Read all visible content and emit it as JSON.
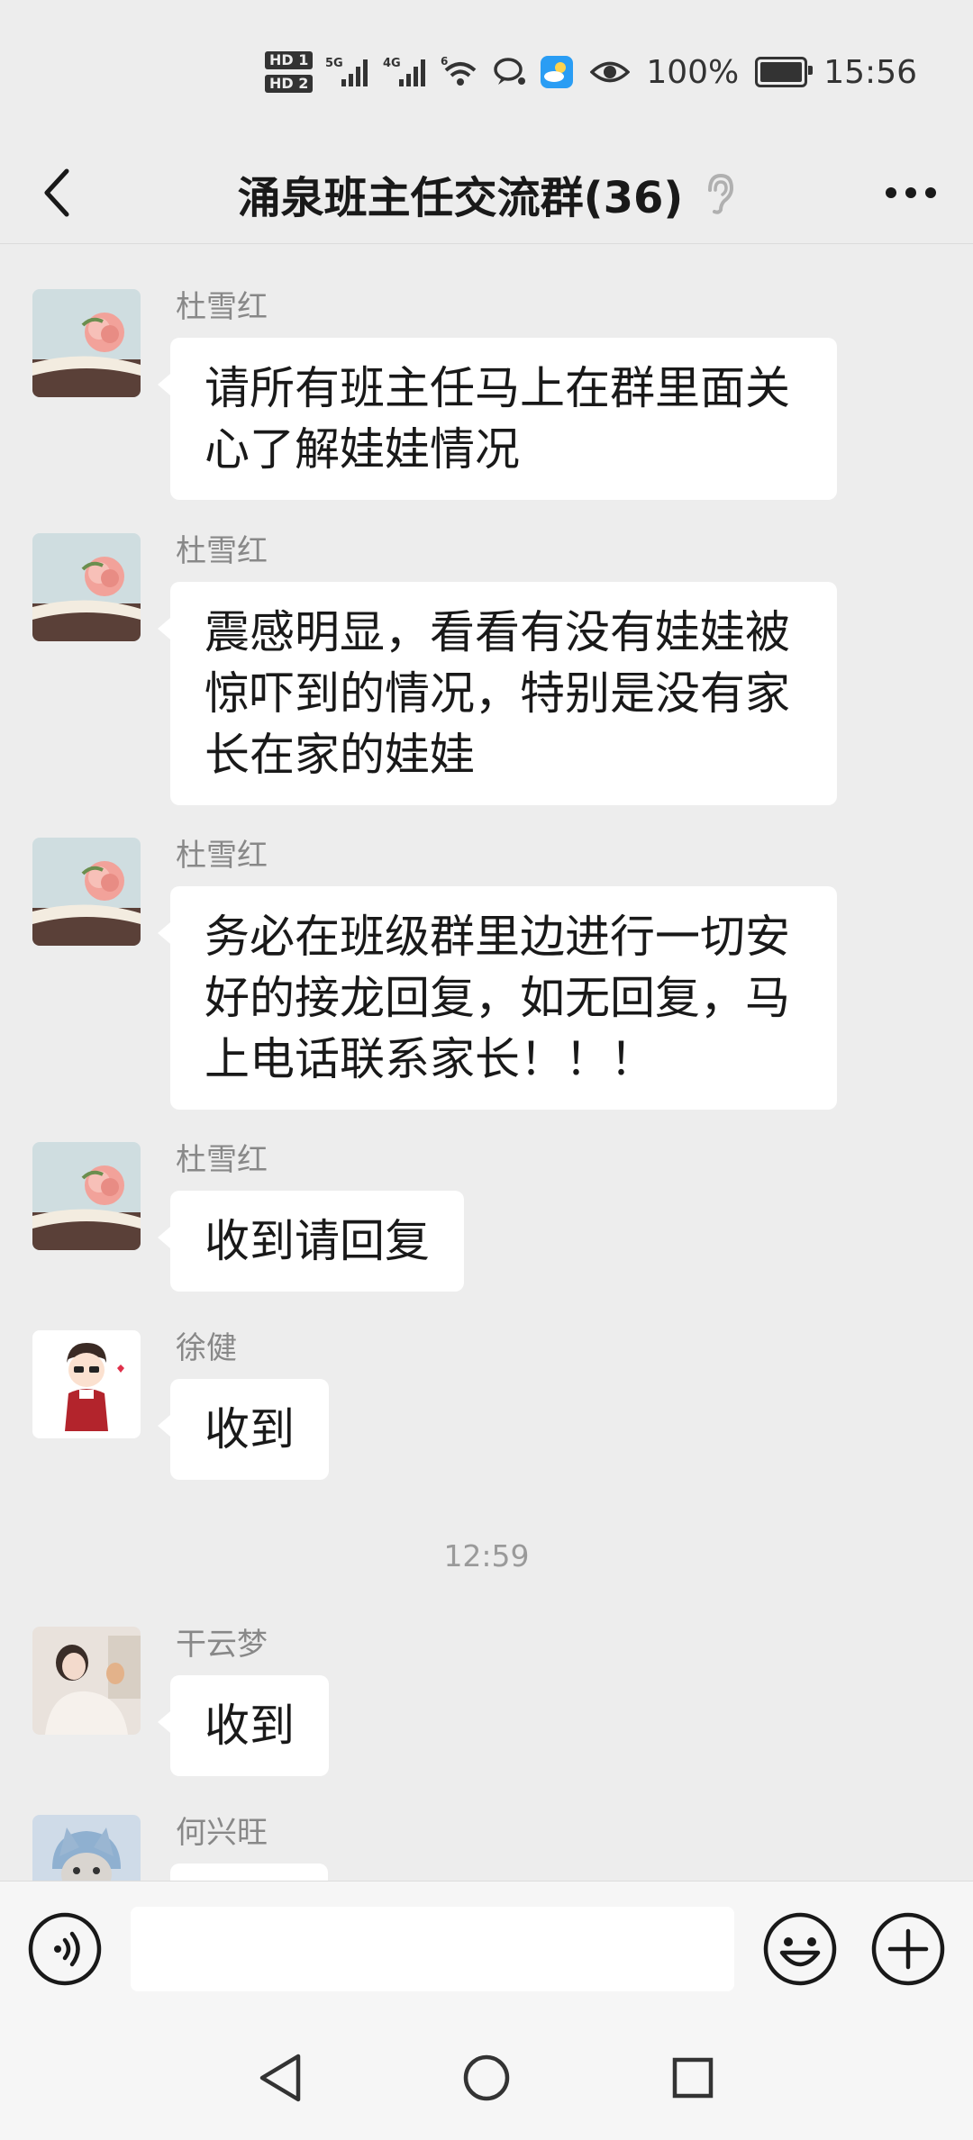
{
  "status_bar": {
    "network": [
      "HD 1",
      "HD 2"
    ],
    "signal_1": "5G",
    "signal_2": "4G",
    "wifi": "6",
    "battery": "100%",
    "battery_level": 1.0,
    "time": "15:56"
  },
  "header": {
    "title": "涌泉班主任交流群(36)",
    "icons": {
      "back": "back-arrow-icon",
      "muted": "ear-icon",
      "more": "more-dots-icon"
    }
  },
  "messages": [
    {
      "sender": "杜雪红",
      "avatar": "rose-book-avatar",
      "lines": [
        "请所有班主任马上在群里面关",
        "心了解娃娃情况"
      ]
    },
    {
      "sender": "杜雪红",
      "avatar": "rose-book-avatar",
      "lines": [
        "震感明显，看看有没有娃娃被",
        "惊吓到的情况，特别是没有家",
        "长在家的娃娃"
      ]
    },
    {
      "sender": "杜雪红",
      "avatar": "rose-book-avatar",
      "lines": [
        "务必在班级群里边进行一切安",
        "好的接龙回复，如无回复，马",
        "上电话联系家长！！！"
      ]
    },
    {
      "sender": "杜雪红",
      "avatar": "rose-book-avatar",
      "lines": [
        "收到请回复"
      ]
    },
    {
      "sender": "徐健",
      "avatar": "cartoon-boy-avatar",
      "lines": [
        "收到"
      ]
    },
    {
      "sender": "干云梦",
      "avatar": "woman-photo-avatar",
      "lines": [
        "收到"
      ]
    },
    {
      "sender": "何兴旺",
      "avatar": "cat-avatar",
      "lines": [
        ""
      ]
    }
  ],
  "timestamp": "12:59",
  "input_bar": {
    "placeholder": "",
    "icons": {
      "voice": "voice-icon",
      "emoji": "emoji-icon",
      "plus": "plus-icon"
    }
  },
  "nav": {
    "icons": [
      "back-triangle-icon",
      "home-circle-icon",
      "recents-square-icon"
    ]
  },
  "colors": {
    "background": "#ededed",
    "bubble": "#ffffff",
    "weather_icon": "#2a9df4"
  }
}
